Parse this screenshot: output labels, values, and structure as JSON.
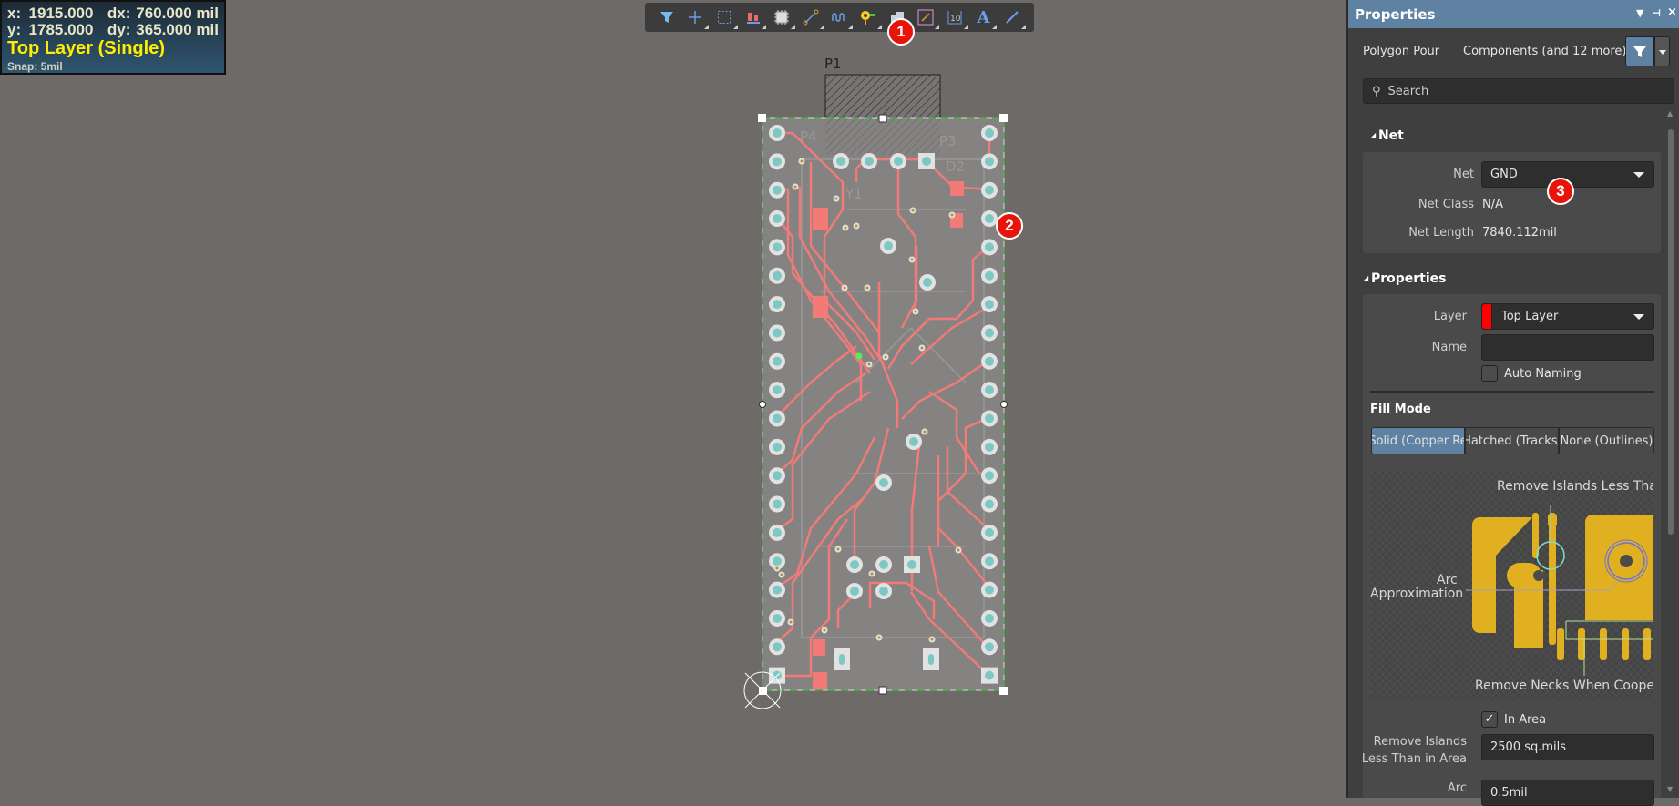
{
  "coords": {
    "x_label": "x:",
    "x": "1915.000",
    "dx_label": "dx:",
    "dx": "760.000 mil",
    "y_label": "y:",
    "y": "1785.000",
    "dy_label": "dy:",
    "dy": "365.000 mil",
    "layer": "Top Layer (Single)",
    "snap": "Snap: 5mil"
  },
  "toolbar": {
    "icons": [
      "filter-icon",
      "cross-probe-icon",
      "select-rect-icon",
      "align-icon",
      "component-icon",
      "route-icon",
      "interactive-length-icon",
      "via-icon",
      "polygon-pour-icon",
      "fill-icon",
      "dimension-icon",
      "text-icon",
      "line-icon"
    ],
    "text_icon_glyph": "A",
    "dimension_glyph": "10"
  },
  "callouts": [
    "1",
    "2",
    "3"
  ],
  "board": {
    "designators": {
      "p1": "P1",
      "p4": "P4",
      "p3": "P3",
      "d2": "D2",
      "y1": "Y1"
    },
    "colors": {
      "copper": "#f47a78",
      "pad": "#e2e2e2",
      "hole": "#7ec8c4",
      "board": "#858382",
      "outline": "#33cc33"
    }
  },
  "panel": {
    "title": "Properties",
    "object_type": "Polygon Pour",
    "filter_text": "Components (and 12 more)",
    "search_placeholder": "Search",
    "net_section": "Net",
    "net_label": "Net",
    "net_value": "GND",
    "net_class_label": "Net Class",
    "net_class_value": "N/A",
    "net_length_label": "Net Length",
    "net_length_value": "7840.112mil",
    "properties_section": "Properties",
    "layer_label": "Layer",
    "layer_value": "Top Layer",
    "layer_color": "#ff0000",
    "name_label": "Name",
    "name_value": "",
    "auto_naming_label": "Auto Naming",
    "auto_naming_checked": false,
    "fill_mode_label": "Fill Mode",
    "fill_modes": [
      "Solid (Copper Re",
      "Hatched (Tracks/",
      "None (Outlines)"
    ],
    "fill_mode_selected": "Solid (Copper Re",
    "diagram": {
      "islands": "Remove Islands Less Than",
      "arc1": "Arc",
      "arc2": "Approximation",
      "necks": "Remove Necks When Cooper",
      "copper_color": "#e0b020"
    },
    "in_area_label": "In Area",
    "in_area_checked": true,
    "remove_islands_label1": "Remove Islands",
    "remove_islands_label2": "Less Than in Area",
    "remove_islands_value": "2500 sq.mils",
    "arc_label": "Arc",
    "arc_value": "0.5mil",
    "accent": "#5f82a3"
  }
}
